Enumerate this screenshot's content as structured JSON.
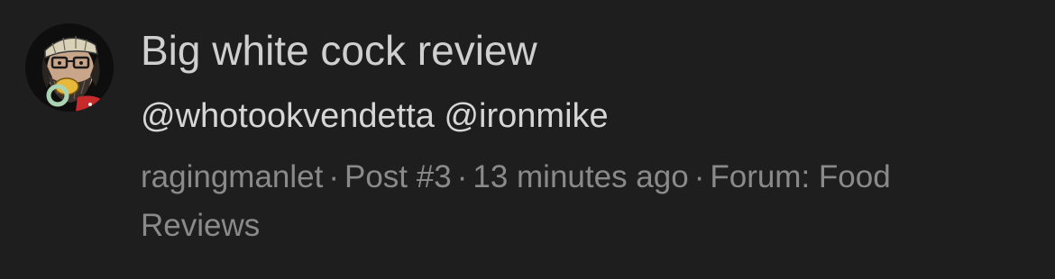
{
  "alert": {
    "title": "Big white cock review",
    "mentions": [
      "@whotookvendetta",
      "@ironmike"
    ],
    "author": "ragingmanlet",
    "post": "Post #3",
    "time": "13 minutes ago",
    "forum": "Forum: Food Reviews",
    "separator": "·"
  },
  "colors": {
    "background": "#1e1e1f",
    "title": "#cfcfcf",
    "meta": "#8a8a8a"
  },
  "icons": {
    "avatar": "cartoon-man-avatar-icon"
  }
}
